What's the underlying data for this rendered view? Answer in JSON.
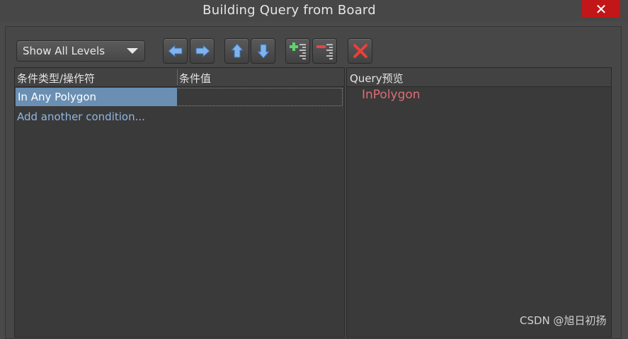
{
  "window": {
    "title": "Building Query from Board",
    "close_glyph": "✕"
  },
  "toolbar": {
    "level_combo": {
      "selected": "Show All Levels"
    },
    "buttons": [
      {
        "icon": "arrow-left-icon"
      },
      {
        "icon": "arrow-right-icon"
      },
      {
        "icon": "arrow-up-icon"
      },
      {
        "icon": "arrow-down-icon"
      },
      {
        "icon": "add-condition-icon"
      },
      {
        "icon": "remove-condition-icon"
      },
      {
        "icon": "delete-icon"
      }
    ]
  },
  "grid": {
    "headers": [
      "条件类型/操作符",
      "条件值"
    ],
    "rows": [
      {
        "condition": "In Any Polygon",
        "value": ""
      }
    ],
    "add_link": "Add another condition..."
  },
  "preview": {
    "header": "Query预览",
    "query": "InPolygon"
  },
  "watermark": "CSDN @旭日初扬",
  "colors": {
    "selection": "#6a8fb3",
    "query_text": "#e06c75",
    "link": "#8fb6e3",
    "close": "#c21618"
  }
}
